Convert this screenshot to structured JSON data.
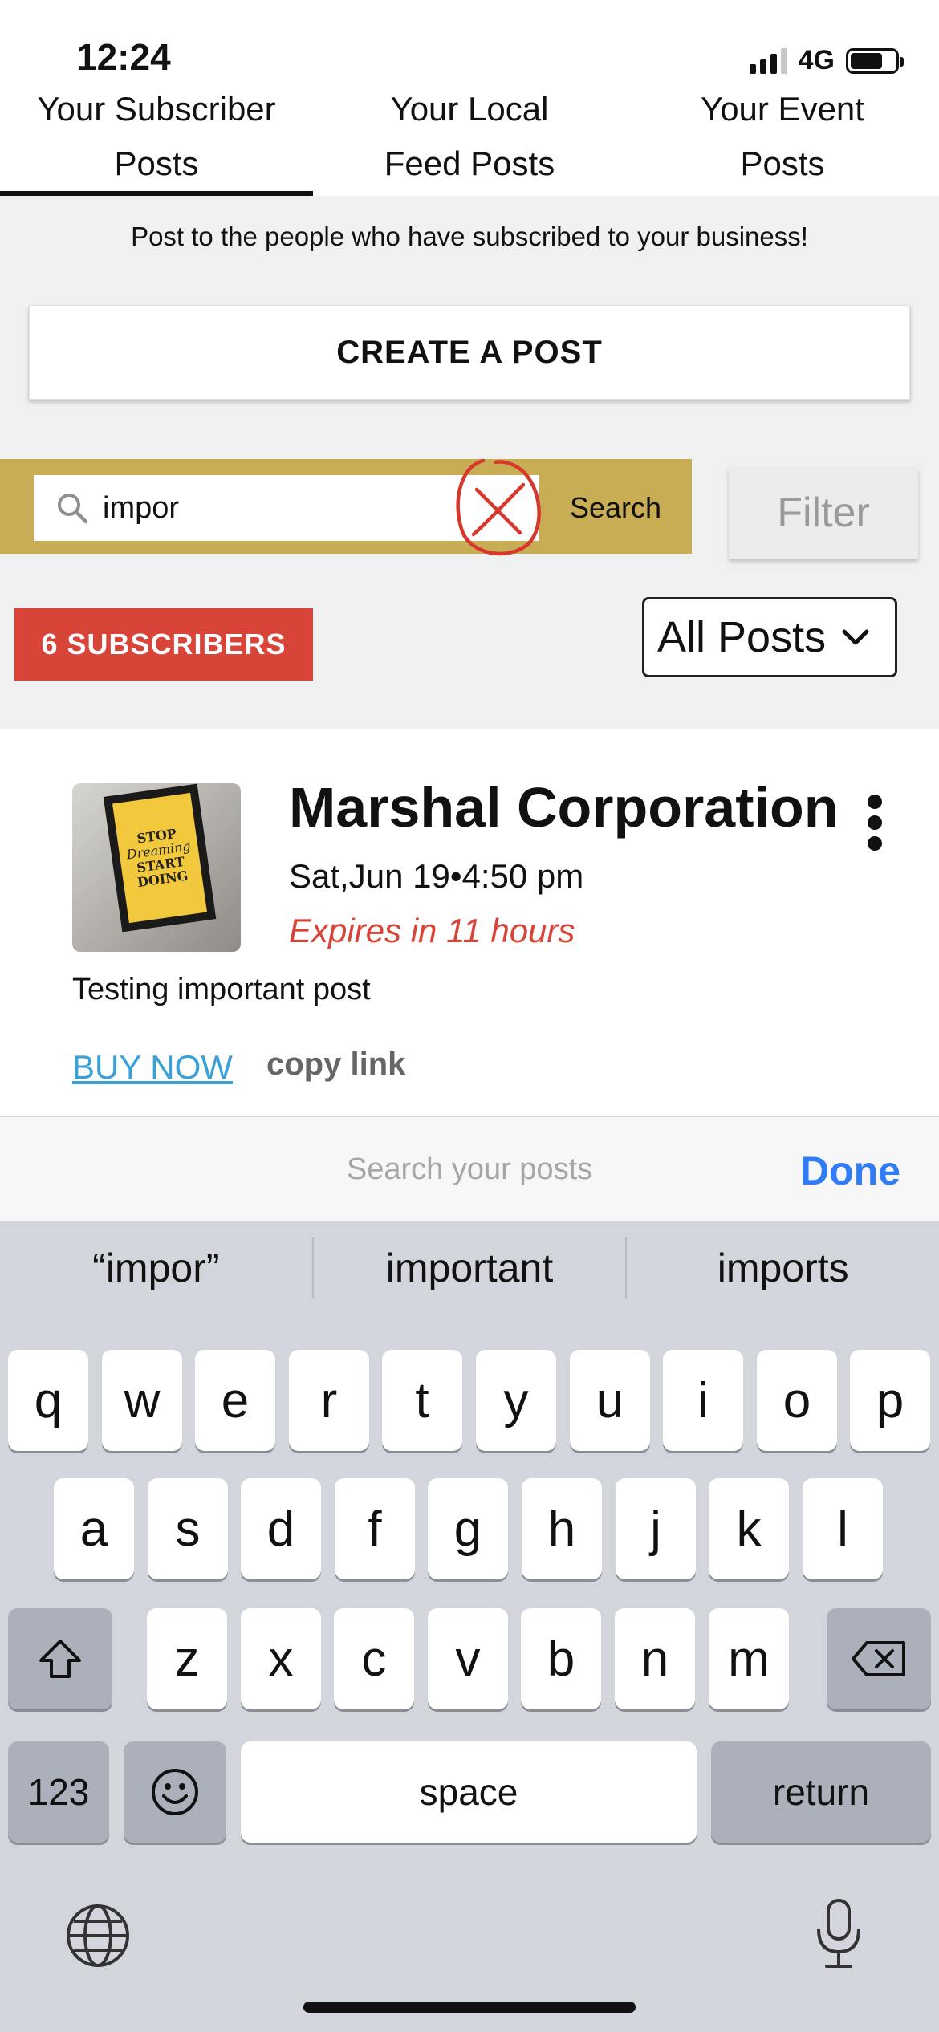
{
  "status_bar": {
    "time": "12:24",
    "network": "4G",
    "battery_level": 0.75,
    "signal_bars": 3
  },
  "tabs": [
    {
      "line1": "Your Subscriber",
      "line2": "Posts",
      "active": true
    },
    {
      "line1": "Your Local",
      "line2": "Feed Posts",
      "active": false
    },
    {
      "line1": "Your Event",
      "line2": "Posts",
      "active": false
    }
  ],
  "intro_text": "Post to the people who have subscribed to your business!",
  "create_post_label": "CREATE A POST",
  "search": {
    "value": "impor",
    "button_label": "Search"
  },
  "filter_label": "Filter",
  "subscribers_badge": "6 SUBSCRIBERS",
  "posts_filter": {
    "selected": "All Posts"
  },
  "post": {
    "title": "Marshal Corporation",
    "date": "Sat,Jun 19•4:50 pm",
    "expiry": "Expires in 11 hours",
    "body": "Testing important post",
    "buy_now_label": "BUY NOW",
    "copy_link_label": "copy link",
    "thumbnail_text": [
      "STOP",
      "Dreaming",
      "START",
      "DOING"
    ]
  },
  "keyboard_accessory": {
    "placeholder": "Search your posts",
    "done_label": "Done"
  },
  "suggestions": [
    "“impor”",
    "important",
    "imports"
  ],
  "keyboard": {
    "row1": [
      "q",
      "w",
      "e",
      "r",
      "t",
      "y",
      "u",
      "i",
      "o",
      "p"
    ],
    "row2": [
      "a",
      "s",
      "d",
      "f",
      "g",
      "h",
      "j",
      "k",
      "l"
    ],
    "row3": [
      "z",
      "x",
      "c",
      "v",
      "b",
      "n",
      "m"
    ],
    "numbers_label": "123",
    "space_label": "space",
    "return_label": "return"
  },
  "colors": {
    "accent_red": "#d84438",
    "search_gold": "#c8ad55",
    "link_blue": "#3aa0d8",
    "done_blue": "#2f7cf6"
  }
}
